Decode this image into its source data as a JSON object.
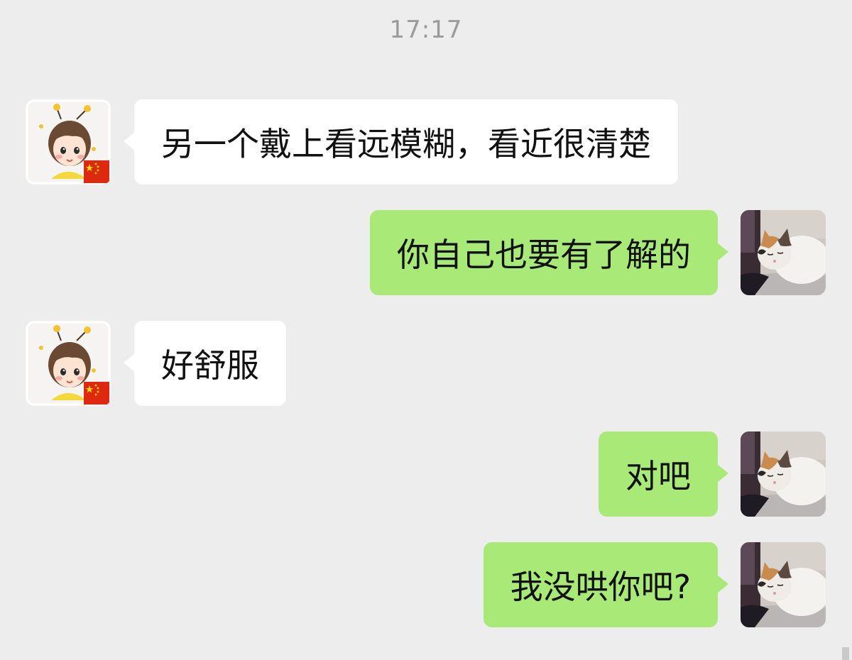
{
  "timestamp": "17:17",
  "contacts": {
    "friend": {
      "avatar_icon": "girl-avatar-icon",
      "badge_icon": "china-flag-icon"
    },
    "me": {
      "avatar_icon": "cat-avatar-icon"
    }
  },
  "colors": {
    "background": "#ededed",
    "incoming_bubble": "#ffffff",
    "outgoing_bubble": "#a9e978",
    "timestamp_text": "#9a9a9a"
  },
  "messages": [
    {
      "sender": "friend",
      "direction": "incoming",
      "text": "另一个戴上看远模糊，看近很清楚"
    },
    {
      "sender": "me",
      "direction": "outgoing",
      "text": "你自己也要有了解的"
    },
    {
      "sender": "friend",
      "direction": "incoming",
      "text": "好舒服"
    },
    {
      "sender": "me",
      "direction": "outgoing",
      "text": "对吧"
    },
    {
      "sender": "me",
      "direction": "outgoing",
      "text": "我没哄你吧?"
    }
  ]
}
